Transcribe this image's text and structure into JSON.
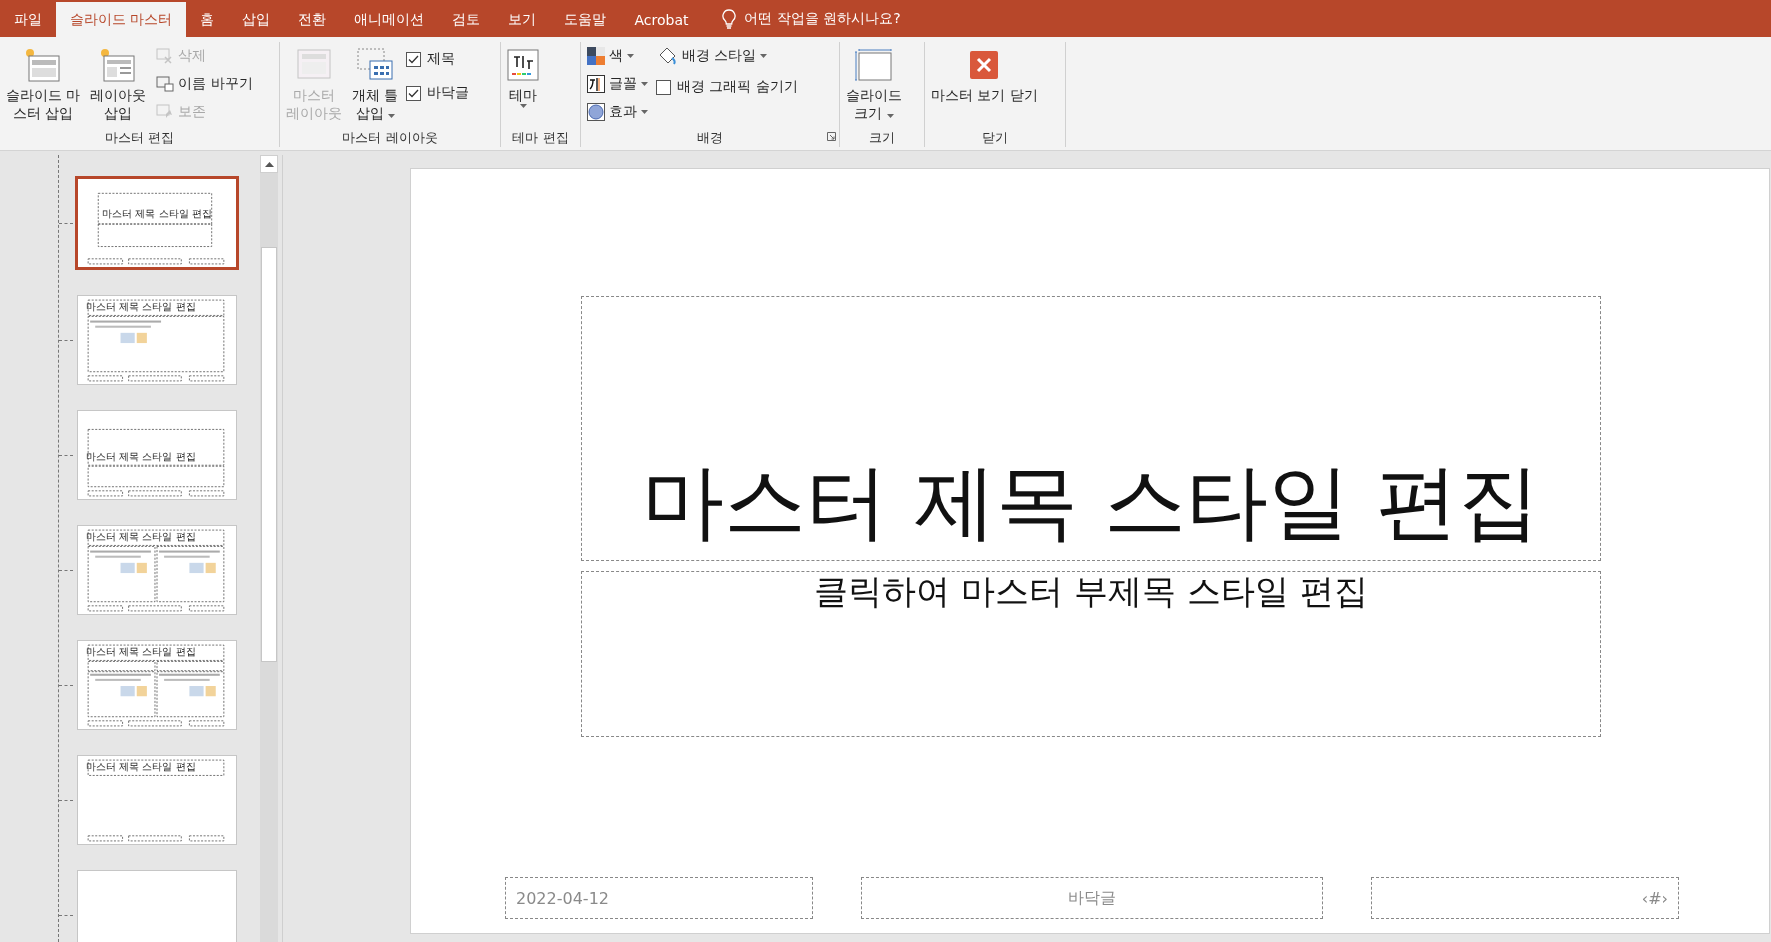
{
  "tabs": [
    {
      "label": "파일",
      "selected": false
    },
    {
      "label": "슬라이드 마스터",
      "selected": true
    },
    {
      "label": "홈",
      "selected": false
    },
    {
      "label": "삽입",
      "selected": false
    },
    {
      "label": "전환",
      "selected": false
    },
    {
      "label": "애니메이션",
      "selected": false
    },
    {
      "label": "검토",
      "selected": false
    },
    {
      "label": "보기",
      "selected": false
    },
    {
      "label": "도움말",
      "selected": false
    },
    {
      "label": "Acrobat",
      "selected": false
    }
  ],
  "tell_me": {
    "placeholder": "어떤 작업을 원하시나요?"
  },
  "ribbon": {
    "groups": [
      {
        "label": "마스터 편집",
        "columns": [
          [
            {
              "kind": "big",
              "lines": [
                "슬라이드 마",
                "스터 삽입"
              ],
              "disabled": false
            }
          ],
          [
            {
              "kind": "big",
              "lines": [
                "레이아웃",
                "삽입"
              ],
              "disabled": false
            }
          ],
          [
            {
              "kind": "small",
              "label": "삭제",
              "disabled": true
            },
            {
              "kind": "small",
              "label": "이름 바꾸기",
              "disabled": false
            },
            {
              "kind": "small",
              "label": "보존",
              "disabled": true
            }
          ]
        ]
      },
      {
        "label": "마스터 레이아웃",
        "columns": [
          [
            {
              "kind": "big",
              "lines": [
                "마스터",
                "레이아웃"
              ],
              "disabled": true
            }
          ],
          [
            {
              "kind": "big",
              "lines": [
                "개체 틀",
                "삽입"
              ],
              "disabled": false,
              "dropdown": true
            }
          ],
          [
            {
              "kind": "check",
              "label": "제목",
              "checked": true
            },
            {
              "kind": "check",
              "label": "바닥글",
              "checked": true
            }
          ]
        ]
      },
      {
        "label": "테마 편집",
        "columns": [
          [
            {
              "kind": "big",
              "lines": [
                "테마"
              ],
              "disabled": false,
              "dropdown": true
            }
          ]
        ]
      },
      {
        "label": "배경",
        "launcher": true,
        "columns": [
          [
            {
              "kind": "small",
              "label": "색",
              "disabled": false,
              "dropdown": true
            },
            {
              "kind": "small",
              "label": "글꼴",
              "disabled": false,
              "dropdown": true
            },
            {
              "kind": "small",
              "label": "효과",
              "disabled": false,
              "dropdown": true
            }
          ],
          [
            {
              "kind": "small",
              "label": "배경 스타일",
              "disabled": false,
              "dropdown": true
            },
            {
              "kind": "check",
              "label": "배경 그래픽 숨기기",
              "checked": false
            }
          ]
        ]
      },
      {
        "label": "크기",
        "columns": [
          [
            {
              "kind": "big",
              "lines": [
                "슬라이드",
                "크기"
              ],
              "disabled": false,
              "dropdown": true
            }
          ]
        ]
      },
      {
        "label": "닫기",
        "columns": [
          [
            {
              "kind": "big",
              "lines": [
                "마스터 보기 닫기"
              ],
              "disabled": false
            }
          ]
        ]
      }
    ]
  },
  "thumbnails": [
    {
      "kind": "title",
      "title": "마스터 제목 스타일 편집",
      "selected": true
    },
    {
      "kind": "content",
      "title": "마스터 제목 스타일 편집",
      "selected": false
    },
    {
      "kind": "section",
      "title": "마스터 제목 스타일 편집",
      "selected": false
    },
    {
      "kind": "two",
      "title": "마스터 제목 스타일 편집",
      "selected": false
    },
    {
      "kind": "compare",
      "title": "마스터 제목 스타일 편집",
      "selected": false
    },
    {
      "kind": "title_only",
      "title": "마스터 제목 스타일 편집",
      "selected": false
    },
    {
      "kind": "blank",
      "selected": false
    }
  ],
  "slide": {
    "title": "마스터 제목 스타일 편집",
    "subtitle": "클릭하여 마스터 부제목 스타일 편집",
    "date": "2022-04-12",
    "footer": "바닥글",
    "number": "‹#›"
  }
}
